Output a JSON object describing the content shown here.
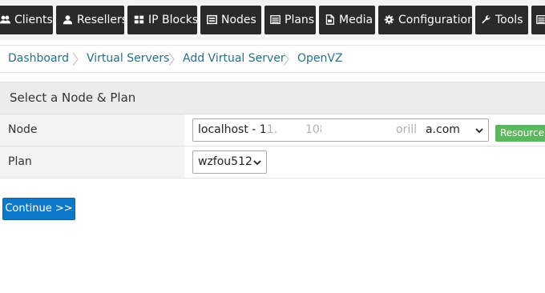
{
  "nav": {
    "items": [
      {
        "label": "Clients",
        "icon": "users-icon"
      },
      {
        "label": "Resellers",
        "icon": "user-icon"
      },
      {
        "label": "IP Blocks",
        "icon": "grid-icon"
      },
      {
        "label": "Nodes",
        "icon": "server-icon"
      },
      {
        "label": "Plans",
        "icon": "list-icon"
      },
      {
        "label": "Media",
        "icon": "file-icon"
      },
      {
        "label": "Configuration",
        "icon": "gear-icon"
      },
      {
        "label": "Tools",
        "icon": "wrench-icon"
      }
    ]
  },
  "breadcrumb": {
    "items": [
      "Dashboard",
      "Virtual Servers",
      "Add Virtual Server",
      "OpenVZ"
    ]
  },
  "panel": {
    "title": "Select a Node & Plan",
    "node": {
      "label": "Node",
      "value_prefix": "localhost - 1",
      "value_mid": "1.",
      "value_a": "108.26 stati",
      "value_b": "orill",
      "value_suffix": "a.com",
      "resource_label": "Resource"
    },
    "plan": {
      "label": "Plan",
      "value": "wzfou512"
    }
  },
  "actions": {
    "continue_label": "Continue >>"
  },
  "colors": {
    "nav_bg": "#2a2a2a",
    "link": "#2a6f8a",
    "primary": "#0e78c9",
    "success": "#5cb85c"
  }
}
